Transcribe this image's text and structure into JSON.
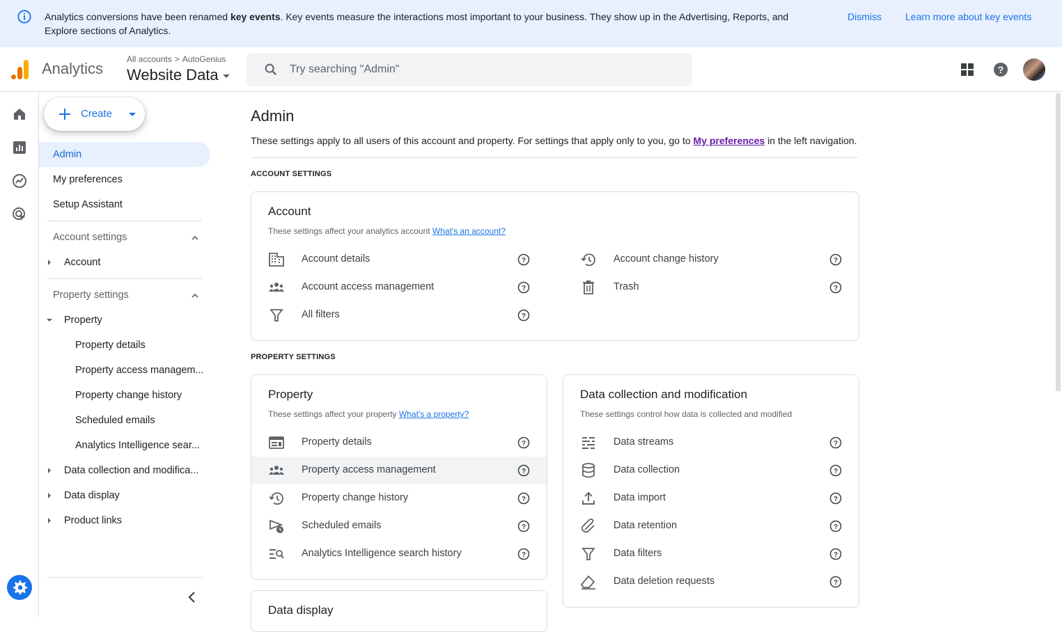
{
  "banner": {
    "text_before": "Analytics conversions have been renamed ",
    "text_bold": "key events",
    "text_after": ". Key events measure the interactions most important to your business. They show up in the Advertising, Reports, and Explore sections of Analytics.",
    "dismiss": "Dismiss",
    "learn_more": "Learn more about key events"
  },
  "header": {
    "product": "Analytics",
    "crumb_root": "All accounts",
    "crumb_account": "AutoGenius",
    "property": "Website Data",
    "search_placeholder": "Try searching \"Admin\""
  },
  "colors": {
    "accent": "#1a73e8",
    "active_bg": "#e8f0fe",
    "logo_orange": "#f9ab00",
    "logo_dark": "#e37400"
  },
  "sidenav": {
    "create": "Create",
    "admin": "Admin",
    "my_preferences": "My preferences",
    "setup_assistant": "Setup Assistant",
    "account_settings": "Account settings",
    "account": "Account",
    "property_settings": "Property settings",
    "property": "Property",
    "property_children": [
      "Property details",
      "Property access managem...",
      "Property change history",
      "Scheduled emails",
      "Analytics Intelligence sear..."
    ],
    "data_collection": "Data collection and modifica...",
    "data_display": "Data display",
    "product_links": "Product links"
  },
  "main": {
    "title": "Admin",
    "desc_before": "These settings apply to all users of this account and property. For settings that apply only to you, go to ",
    "desc_link": "My preferences",
    "desc_after": " in the left navigation.",
    "account_settings_label": "ACCOUNT SETTINGS",
    "property_settings_label": "PROPERTY SETTINGS",
    "account_card": {
      "title": "Account",
      "sub": "These settings affect your analytics account",
      "sub_link": "What's an account?",
      "left": [
        "Account details",
        "Account access management",
        "All filters"
      ],
      "right": [
        "Account change history",
        "Trash"
      ]
    },
    "property_card": {
      "title": "Property",
      "sub": "These settings affect your property",
      "sub_link": "What's a property?",
      "items": [
        "Property details",
        "Property access management",
        "Property change history",
        "Scheduled emails",
        "Analytics Intelligence search history"
      ]
    },
    "data_card": {
      "title": "Data collection and modification",
      "sub": "These settings control how data is collected and modified",
      "items": [
        "Data streams",
        "Data collection",
        "Data import",
        "Data retention",
        "Data filters",
        "Data deletion requests"
      ]
    },
    "display_card": {
      "title": "Data display"
    }
  }
}
